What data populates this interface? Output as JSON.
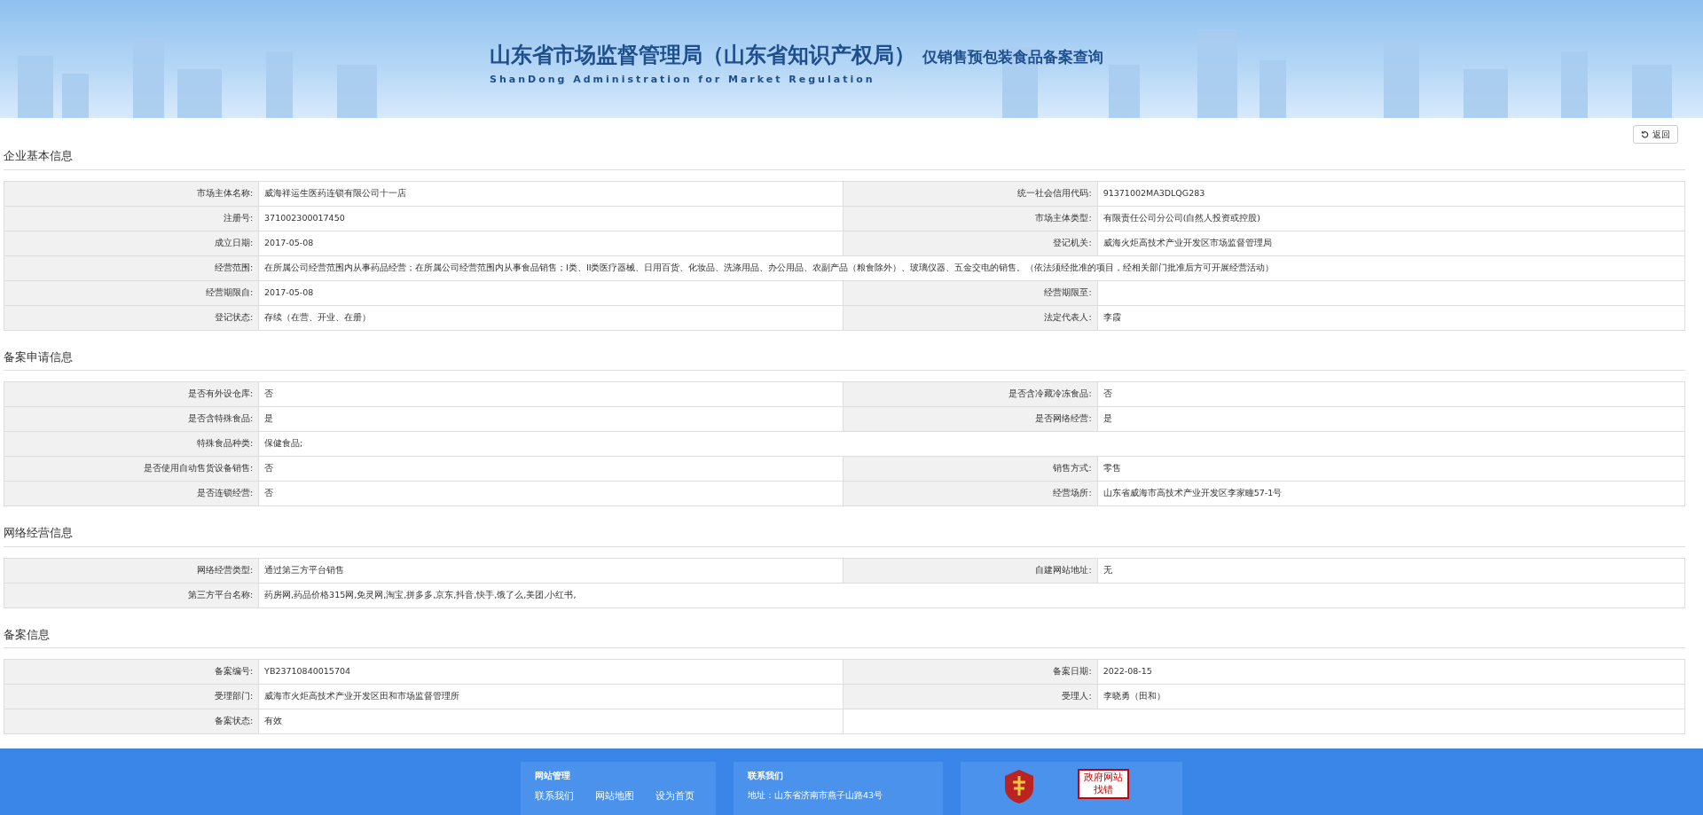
{
  "header": {
    "title": "山东省市场监督管理局（山东省知识产权局）",
    "subtitle": "仅销售预包装食品备案查询",
    "english": "ShanDong Administration for Market Regulation"
  },
  "back_button": {
    "label": "返回"
  },
  "sections": [
    {
      "title": "企业基本信息",
      "rows": [
        {
          "kind": "pair",
          "cells": [
            {
              "label": "市场主体名称:",
              "value": "威海祥运生医药连锁有限公司十一店"
            },
            {
              "label": "统一社会信用代码:",
              "value": "91371002MA3DLQG283"
            }
          ]
        },
        {
          "kind": "pair",
          "cells": [
            {
              "label": "注册号:",
              "value": "371002300017450"
            },
            {
              "label": "市场主体类型:",
              "value": "有限责任公司分公司(自然人投资或控股)"
            }
          ]
        },
        {
          "kind": "pair",
          "cells": [
            {
              "label": "成立日期:",
              "value": "2017-05-08"
            },
            {
              "label": "登记机关:",
              "value": "威海火炬高技术产业开发区市场监督管理局"
            }
          ]
        },
        {
          "kind": "wide",
          "cells": [
            {
              "label": "经营范围:",
              "value": "在所属公司经营范围内从事药品经营；在所属公司经营范围内从事食品销售；I类、II类医疗器械、日用百货、化妆品、洗涤用品、办公用品、农副产品（粮食除外）、玻璃仪器、五金交电的销售。（依法须经批准的项目，经相关部门批准后方可开展经营活动）"
            }
          ]
        },
        {
          "kind": "pair",
          "cells": [
            {
              "label": "经营期限自:",
              "value": "2017-05-08"
            },
            {
              "label": "经营期限至:"
            }
          ]
        },
        {
          "kind": "pair",
          "cells": [
            {
              "label": "登记状态:",
              "value": "存续（在营、开业、在册）"
            },
            {
              "label": "法定代表人:",
              "value": "李霞"
            }
          ]
        }
      ]
    },
    {
      "title": "备案申请信息",
      "rows": [
        {
          "kind": "pair",
          "cells": [
            {
              "label": "是否有外设仓库:",
              "value": "否"
            },
            {
              "label": "是否含冷藏冷冻食品:",
              "value": "否"
            }
          ]
        },
        {
          "kind": "pair",
          "cells": [
            {
              "label": "是否含特殊食品:",
              "value": "是"
            },
            {
              "label": "是否网络经营:",
              "value": "是"
            }
          ]
        },
        {
          "kind": "wide",
          "cells": [
            {
              "label": "特殊食品种类:",
              "value": "保健食品;"
            }
          ]
        },
        {
          "kind": "pair",
          "cells": [
            {
              "label": "是否使用自动售货设备销售:",
              "value": "否"
            },
            {
              "label": "销售方式:",
              "value": "零售"
            }
          ]
        },
        {
          "kind": "pair",
          "cells": [
            {
              "label": "是否连锁经营:",
              "value": "否"
            },
            {
              "label": "经营场所:",
              "value": "山东省威海市高技术产业开发区李家疃57-1号"
            }
          ]
        }
      ]
    },
    {
      "title": "网络经营信息",
      "rows": [
        {
          "kind": "pair",
          "cells": [
            {
              "label": "网络经营类型:",
              "value": "通过第三方平台销售"
            },
            {
              "label": "自建网站地址:",
              "value": "无"
            }
          ]
        },
        {
          "kind": "wide",
          "cells": [
            {
              "label": "第三方平台名称:",
              "value": "药房网,药品价格315网,免灵网,淘宝,拼多多,京东,抖音,快手,饿了么,美团,小红书,"
            }
          ]
        }
      ]
    },
    {
      "title": "备案信息",
      "rows": [
        {
          "kind": "pair",
          "cells": [
            {
              "label": "备案编号:",
              "value": "YB23710840015704"
            },
            {
              "label": "备案日期:",
              "value": "2022-08-15"
            }
          ]
        },
        {
          "kind": "pair",
          "cells": [
            {
              "label": "受理部门:",
              "value": "威海市火炬高技术产业开发区田和市场监督管理所"
            },
            {
              "label": "受理人:",
              "value": "李晓勇（田和）"
            }
          ]
        },
        {
          "kind": "half",
          "cells": [
            {
              "label": "备案状态:",
              "value": "有效"
            }
          ]
        }
      ]
    }
  ],
  "footer": {
    "site_title": "网站管理",
    "site_links": [
      "联系我们",
      "网站地图",
      "设为首页"
    ],
    "contact_title": "联系我们",
    "address": "地址：山东省济南市燕子山路43号",
    "badge_top": "政府网站",
    "badge_bottom": "找错"
  }
}
